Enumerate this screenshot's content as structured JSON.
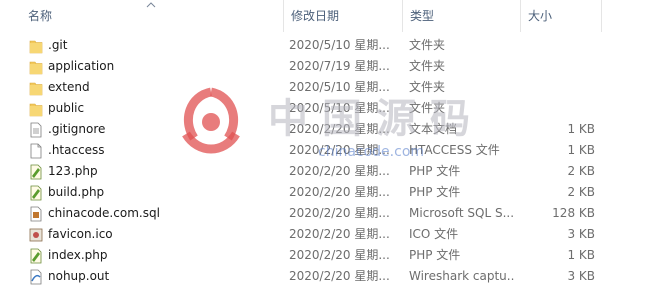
{
  "columns": {
    "name": "名称",
    "date": "修改日期",
    "type": "类型",
    "size": "大小"
  },
  "rows": [
    {
      "name": ".git",
      "date": "2020/5/10 星期...",
      "type": "文件夹",
      "size": "",
      "icon": "folder-icon"
    },
    {
      "name": "application",
      "date": "2020/7/19 星期...",
      "type": "文件夹",
      "size": "",
      "icon": "folder-icon"
    },
    {
      "name": "extend",
      "date": "2020/5/10 星期...",
      "type": "文件夹",
      "size": "",
      "icon": "folder-icon"
    },
    {
      "name": "public",
      "date": "2020/5/10 星期...",
      "type": "文件夹",
      "size": "",
      "icon": "folder-icon"
    },
    {
      "name": ".gitignore",
      "date": "2020/2/20 星期...",
      "type": "文本文档",
      "size": "1 KB",
      "icon": "text-file-icon"
    },
    {
      "name": ".htaccess",
      "date": "2020/2/20 星期...",
      "type": "HTACCESS 文件",
      "size": "1 KB",
      "icon": "blank-file-icon"
    },
    {
      "name": "123.php",
      "date": "2020/2/20 星期...",
      "type": "PHP 文件",
      "size": "2 KB",
      "icon": "php-file-icon"
    },
    {
      "name": "build.php",
      "date": "2020/2/20 星期...",
      "type": "PHP 文件",
      "size": "2 KB",
      "icon": "php-file-icon"
    },
    {
      "name": "chinacode.com.sql",
      "date": "2020/2/20 星期...",
      "type": "Microsoft SQL S...",
      "size": "128 KB",
      "icon": "sql-file-icon"
    },
    {
      "name": "favicon.ico",
      "date": "2020/2/20 星期...",
      "type": "ICO 文件",
      "size": "3 KB",
      "icon": "ico-file-icon"
    },
    {
      "name": "index.php",
      "date": "2020/2/20 星期...",
      "type": "PHP 文件",
      "size": "1 KB",
      "icon": "php-file-icon"
    },
    {
      "name": "nohup.out",
      "date": "2020/2/20 星期...",
      "type": "Wireshark captu...",
      "size": "3 KB",
      "icon": "wireshark-file-icon"
    }
  ],
  "watermark": {
    "text": "中国源码",
    "url": "chinacode.com"
  },
  "colors": {
    "header_text": "#4c607a",
    "folder": "#f2c85b",
    "watermark_logo": "#e05050"
  }
}
